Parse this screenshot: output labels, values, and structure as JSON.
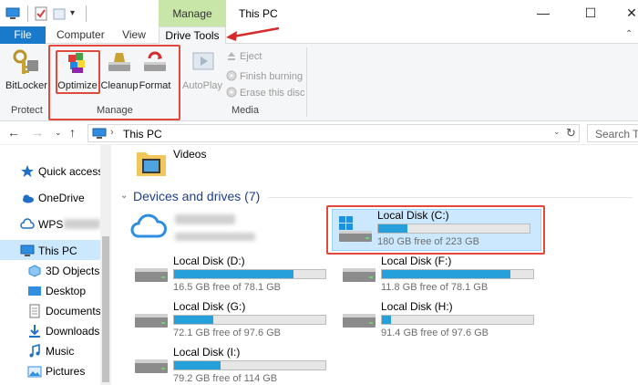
{
  "window": {
    "title": "This PC",
    "context_group": "Manage"
  },
  "ribbon": {
    "tabs": [
      "File",
      "Computer",
      "View",
      "Drive Tools"
    ],
    "active_tab": "Drive Tools",
    "buttons": {
      "bitlocker": "BitLocker",
      "optimize": "Optimize",
      "cleanup": "Cleanup",
      "format": "Format",
      "autoplay": "AutoPlay",
      "eject": "Eject",
      "finish_burning": "Finish burning",
      "erase_disc": "Erase this disc"
    },
    "groups": {
      "protect": "Protect",
      "manage": "Manage",
      "media": "Media"
    }
  },
  "address": {
    "path": "This PC",
    "search_placeholder": "Search Th"
  },
  "nav": {
    "items": [
      "Quick access",
      "OneDrive",
      "WPS",
      "This PC",
      "3D Objects",
      "Desktop",
      "Documents",
      "Downloads",
      "Music",
      "Pictures"
    ],
    "selected": "This PC"
  },
  "content": {
    "folder_label": "Videos",
    "section_title": "Devices and drives (7)",
    "drives": [
      {
        "name": "Local Disk (C:)",
        "free": "180 GB free of 223 GB",
        "used_fraction": 0.19
      },
      {
        "name": "Local Disk (D:)",
        "free": "16.5 GB free of 78.1 GB",
        "used_fraction": 0.79
      },
      {
        "name": "Local Disk (F:)",
        "free": "11.8 GB free of 78.1 GB",
        "used_fraction": 0.85
      },
      {
        "name": "Local Disk (G:)",
        "free": "72.1 GB free of 97.6 GB",
        "used_fraction": 0.26
      },
      {
        "name": "Local Disk (H:)",
        "free": "91.4 GB free of 97.6 GB",
        "used_fraction": 0.06
      },
      {
        "name": "Local Disk (I:)",
        "free": "79.2 GB free of 114 GB",
        "used_fraction": 0.31
      }
    ]
  },
  "colors": {
    "accent": "#1979ca",
    "context_tab": "#c8e6a8",
    "highlight_box": "#e04a3c",
    "selection": "#cce8ff",
    "drive_bar": "#26a0da"
  }
}
